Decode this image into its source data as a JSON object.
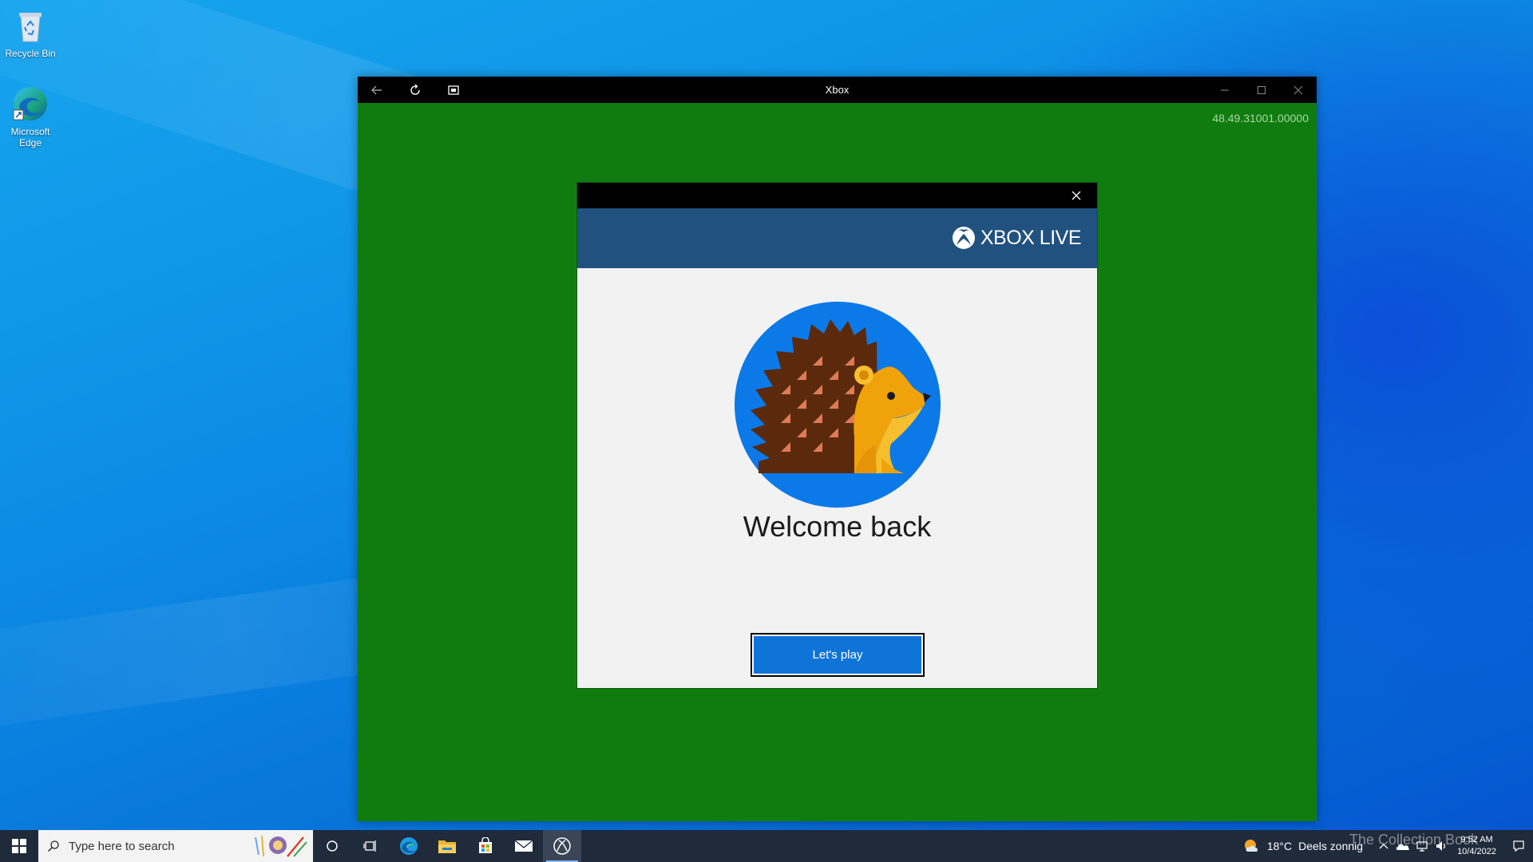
{
  "desktop": {
    "icons": [
      {
        "label": "Recycle Bin",
        "icon": "recycle-bin-icon"
      },
      {
        "label": "Microsoft Edge",
        "icon": "edge-icon"
      }
    ]
  },
  "window": {
    "title": "Xbox",
    "version": "48.49.31001.00000",
    "buttons": [
      "back-arrow-icon",
      "refresh-icon",
      "snapshot-icon",
      "minimize-icon",
      "maximize-icon",
      "close-icon"
    ]
  },
  "dialog": {
    "brand": "XBOX LIVE",
    "welcome": "Welcome back",
    "play_label": "Let's play",
    "avatar": "hedgehog-avatar",
    "colors": {
      "header": "#21517f",
      "button": "#0f74d8",
      "background": "#107c10"
    }
  },
  "taskbar": {
    "search_placeholder": "Type here to search",
    "apps": [
      "cortana-icon",
      "task-view-icon",
      "edge-icon",
      "file-explorer-icon",
      "store-icon",
      "mail-icon",
      "xbox-icon"
    ],
    "weather": {
      "temp": "18°C",
      "text": "Deels zonnig"
    },
    "clock": {
      "time": "9:52 AM",
      "date": "10/4/2022"
    }
  },
  "watermark": "The Collection Book"
}
